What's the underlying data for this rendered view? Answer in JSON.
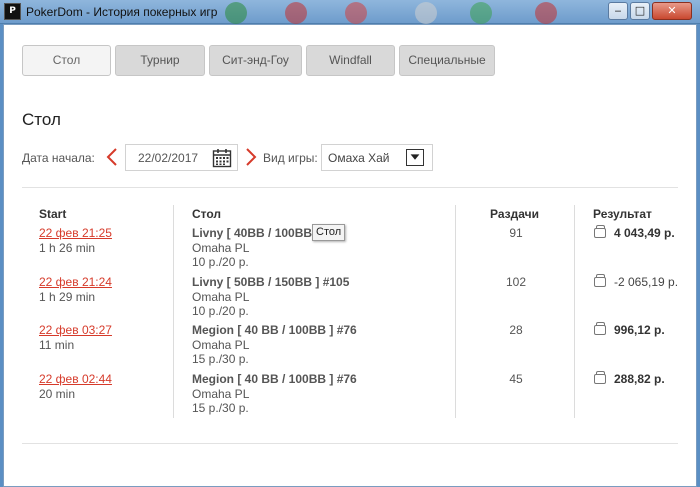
{
  "window": {
    "title": "PokerDom - История покерных игр",
    "app_icon_text": "P",
    "minimize": "‒",
    "maximize": "□",
    "close": "✕"
  },
  "tabs": [
    {
      "label": "Стол",
      "active": true
    },
    {
      "label": "Турнир",
      "active": false
    },
    {
      "label": "Сит-энд-Гоу",
      "active": false
    },
    {
      "label": "Windfall",
      "active": false
    },
    {
      "label": "Специальные",
      "active": false
    }
  ],
  "section_title": "Стол",
  "filters": {
    "start_date_label": "Дата начала:",
    "start_date_value": "22/02/2017",
    "game_type_label": "Вид игры:",
    "game_type_value": "Омаха Хай"
  },
  "table": {
    "headers": {
      "start": "Start",
      "table": "Стол",
      "hands": "Раздачи",
      "result": "Результат"
    },
    "rows": [
      {
        "date": "22 фев 21:25",
        "duration": "1 h 26 min",
        "name": "Livny [ 40BB / 100BB",
        "game": "Omaha PL",
        "stakes": "10 р./20 р.",
        "hands": "91",
        "result": "4 043,49 р.",
        "result_bold": true
      },
      {
        "date": "22 фев 21:24",
        "duration": "1 h 29 min",
        "name": "Livny [ 50BB / 150BB ] #105",
        "game": "Omaha PL",
        "stakes": "10 р./20 р.",
        "hands": "102",
        "result": "-2 065,19 р.",
        "result_bold": false
      },
      {
        "date": "22 фев 03:27",
        "duration": "11 min",
        "name": "Megion [ 40 BB / 100BB ] #76",
        "game": "Omaha PL",
        "stakes": "15 р./30 р.",
        "hands": "28",
        "result": "996,12 р.",
        "result_bold": true
      },
      {
        "date": "22 фев 02:44",
        "duration": "20 min",
        "name": "Megion [ 40 BB / 100BB ] #76",
        "game": "Omaha PL",
        "stakes": "15 р./30 р.",
        "hands": "45",
        "result": "288,82 р.",
        "result_bold": true
      }
    ]
  },
  "tooltip": "Стол",
  "colors": {
    "accent_red": "#d63a2a"
  }
}
